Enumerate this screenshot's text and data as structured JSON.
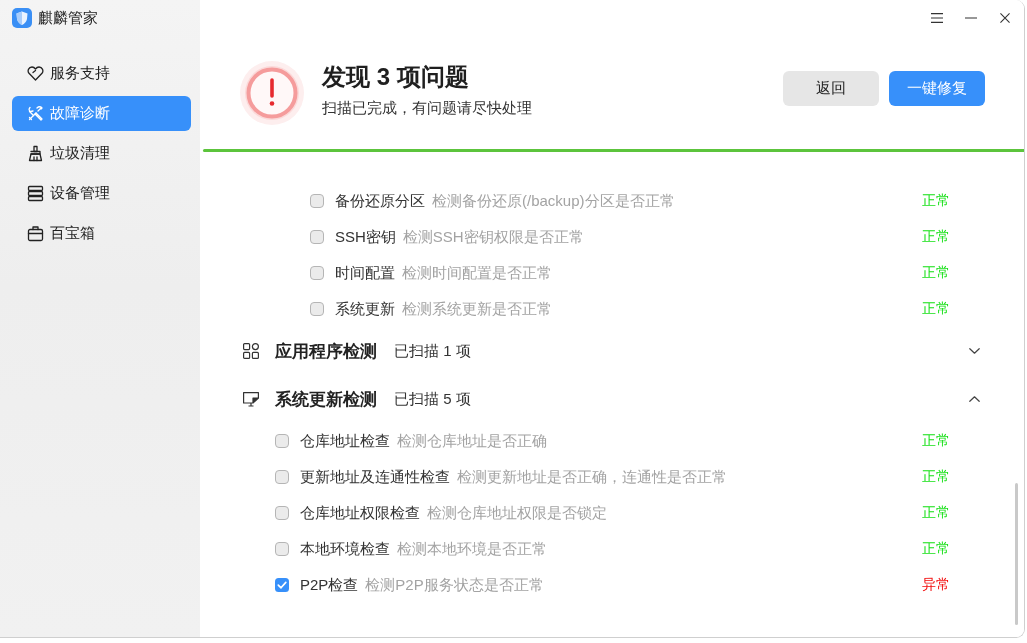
{
  "app": {
    "title": "麒麟管家"
  },
  "sidebar": {
    "items": [
      {
        "label": "服务支持",
        "selected": false
      },
      {
        "label": "故障诊断",
        "selected": true
      },
      {
        "label": "垃圾清理",
        "selected": false
      },
      {
        "label": "设备管理",
        "selected": false
      },
      {
        "label": "百宝箱",
        "selected": false
      }
    ]
  },
  "header": {
    "title": "发现 3 项问题",
    "subtitle": "扫描已完成，有问题请尽快处理",
    "buttons": [
      {
        "label": "返回",
        "kind": "secondary"
      },
      {
        "label": "一键修复",
        "kind": "primary"
      }
    ]
  },
  "progress": {
    "level": 1
  },
  "earlier_group_items": [
    {
      "name": "备份还原分区",
      "description": "检测备份还原(/backup)分区是否正常",
      "status": "正常",
      "abnormal": false,
      "checked": false
    },
    {
      "name": "SSH密钥",
      "description": "检测SSH密钥权限是否正常",
      "status": "正常",
      "abnormal": false,
      "checked": false
    },
    {
      "name": "时间配置",
      "description": "检测时间配置是否正常",
      "status": "正常",
      "abnormal": false,
      "checked": false
    },
    {
      "name": "系统更新",
      "description": "检测系统更新是否正常",
      "status": "正常",
      "abnormal": false,
      "checked": false
    }
  ],
  "groups": [
    {
      "title": "应用程序检测",
      "count": "已扫描 1 项",
      "expanded": false
    },
    {
      "title": "系统更新检测",
      "count": "已扫描 5 项",
      "expanded": true,
      "items": [
        {
          "name": "仓库地址检查",
          "description": "检测仓库地址是否正确",
          "status": "正常",
          "abnormal": false,
          "checked": false
        },
        {
          "name": "更新地址及连通性检查",
          "description": "检测更新地址是否正确，连通性是否正常",
          "status": "正常",
          "abnormal": false,
          "checked": false
        },
        {
          "name": "仓库地址权限检查",
          "description": "检测仓库地址权限是否锁定",
          "status": "正常",
          "abnormal": false,
          "checked": false
        },
        {
          "name": "本地环境检查",
          "description": "检测本地环境是否正常",
          "status": "正常",
          "abnormal": false,
          "checked": false
        },
        {
          "name": "P2P检查",
          "description": "检测P2P服务状态是否正常",
          "status": "异常",
          "abnormal": true,
          "checked": true
        }
      ]
    }
  ]
}
